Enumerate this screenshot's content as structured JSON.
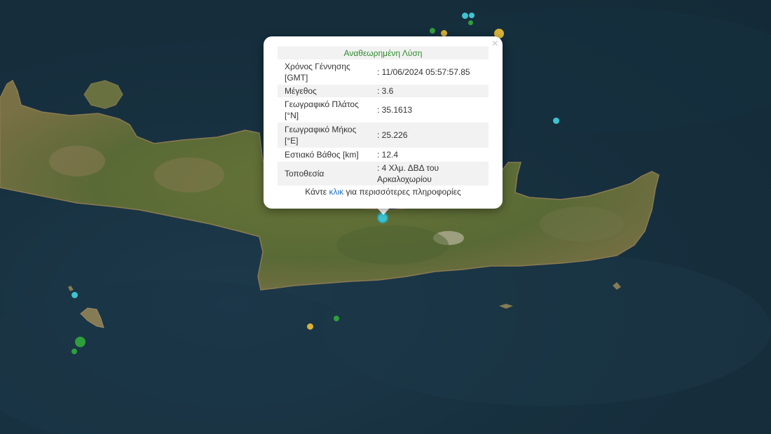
{
  "popup": {
    "title": "Αναθεωρημένη Λύση",
    "close_glyph": "×",
    "rows": [
      {
        "label": "Χρόνος Γέννησης [GMT]",
        "value": ": 11/06/2024 05:57:57.85"
      },
      {
        "label": "Μέγεθος",
        "value": ": 3.6"
      },
      {
        "label": "Γεωγραφικό Πλάτος [°N]",
        "value": ": 35.1613"
      },
      {
        "label": "Γεωγραφικό Μήκος [°E]",
        "value": ": 25.226"
      },
      {
        "label": "Εστιακό Βάθος [km]",
        "value": ": 12.4"
      },
      {
        "label": "Τοποθεσία",
        "value": ": 4 Χλμ. ΔΒΔ του Αρκαλοχωρίου"
      }
    ],
    "footer_prefix": "Κάντε",
    "footer_link": "κλικ",
    "footer_suffix": "για περισσότερες πληροφορίες"
  },
  "colors": {
    "sea": "#17303f",
    "land": "#5d6c3a",
    "marker_cyan": "#3ec4d0",
    "marker_green": "#2f9e3c",
    "marker_yellow": "#d9b238",
    "popup_title": "#2e8b2e",
    "link": "#1a73c9"
  }
}
